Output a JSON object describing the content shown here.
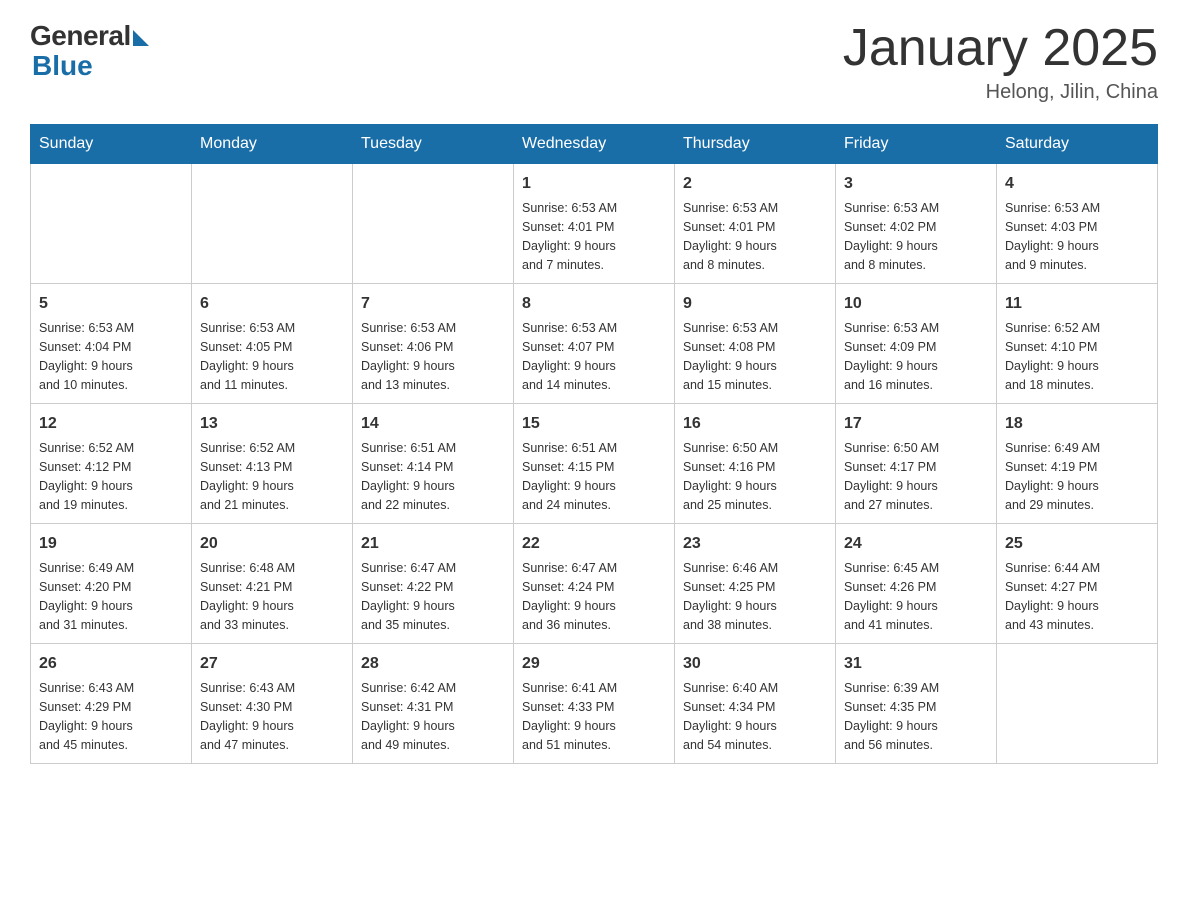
{
  "header": {
    "logo_general": "General",
    "logo_blue": "Blue",
    "title": "January 2025",
    "subtitle": "Helong, Jilin, China"
  },
  "days_of_week": [
    "Sunday",
    "Monday",
    "Tuesday",
    "Wednesday",
    "Thursday",
    "Friday",
    "Saturday"
  ],
  "weeks": [
    [
      null,
      null,
      null,
      {
        "date": "1",
        "sunrise": "6:53 AM",
        "sunset": "4:01 PM",
        "daylight": "9 hours and 7 minutes."
      },
      {
        "date": "2",
        "sunrise": "6:53 AM",
        "sunset": "4:01 PM",
        "daylight": "9 hours and 8 minutes."
      },
      {
        "date": "3",
        "sunrise": "6:53 AM",
        "sunset": "4:02 PM",
        "daylight": "9 hours and 8 minutes."
      },
      {
        "date": "4",
        "sunrise": "6:53 AM",
        "sunset": "4:03 PM",
        "daylight": "9 hours and 9 minutes."
      }
    ],
    [
      {
        "date": "5",
        "sunrise": "6:53 AM",
        "sunset": "4:04 PM",
        "daylight": "9 hours and 10 minutes."
      },
      {
        "date": "6",
        "sunrise": "6:53 AM",
        "sunset": "4:05 PM",
        "daylight": "9 hours and 11 minutes."
      },
      {
        "date": "7",
        "sunrise": "6:53 AM",
        "sunset": "4:06 PM",
        "daylight": "9 hours and 13 minutes."
      },
      {
        "date": "8",
        "sunrise": "6:53 AM",
        "sunset": "4:07 PM",
        "daylight": "9 hours and 14 minutes."
      },
      {
        "date": "9",
        "sunrise": "6:53 AM",
        "sunset": "4:08 PM",
        "daylight": "9 hours and 15 minutes."
      },
      {
        "date": "10",
        "sunrise": "6:53 AM",
        "sunset": "4:09 PM",
        "daylight": "9 hours and 16 minutes."
      },
      {
        "date": "11",
        "sunrise": "6:52 AM",
        "sunset": "4:10 PM",
        "daylight": "9 hours and 18 minutes."
      }
    ],
    [
      {
        "date": "12",
        "sunrise": "6:52 AM",
        "sunset": "4:12 PM",
        "daylight": "9 hours and 19 minutes."
      },
      {
        "date": "13",
        "sunrise": "6:52 AM",
        "sunset": "4:13 PM",
        "daylight": "9 hours and 21 minutes."
      },
      {
        "date": "14",
        "sunrise": "6:51 AM",
        "sunset": "4:14 PM",
        "daylight": "9 hours and 22 minutes."
      },
      {
        "date": "15",
        "sunrise": "6:51 AM",
        "sunset": "4:15 PM",
        "daylight": "9 hours and 24 minutes."
      },
      {
        "date": "16",
        "sunrise": "6:50 AM",
        "sunset": "4:16 PM",
        "daylight": "9 hours and 25 minutes."
      },
      {
        "date": "17",
        "sunrise": "6:50 AM",
        "sunset": "4:17 PM",
        "daylight": "9 hours and 27 minutes."
      },
      {
        "date": "18",
        "sunrise": "6:49 AM",
        "sunset": "4:19 PM",
        "daylight": "9 hours and 29 minutes."
      }
    ],
    [
      {
        "date": "19",
        "sunrise": "6:49 AM",
        "sunset": "4:20 PM",
        "daylight": "9 hours and 31 minutes."
      },
      {
        "date": "20",
        "sunrise": "6:48 AM",
        "sunset": "4:21 PM",
        "daylight": "9 hours and 33 minutes."
      },
      {
        "date": "21",
        "sunrise": "6:47 AM",
        "sunset": "4:22 PM",
        "daylight": "9 hours and 35 minutes."
      },
      {
        "date": "22",
        "sunrise": "6:47 AM",
        "sunset": "4:24 PM",
        "daylight": "9 hours and 36 minutes."
      },
      {
        "date": "23",
        "sunrise": "6:46 AM",
        "sunset": "4:25 PM",
        "daylight": "9 hours and 38 minutes."
      },
      {
        "date": "24",
        "sunrise": "6:45 AM",
        "sunset": "4:26 PM",
        "daylight": "9 hours and 41 minutes."
      },
      {
        "date": "25",
        "sunrise": "6:44 AM",
        "sunset": "4:27 PM",
        "daylight": "9 hours and 43 minutes."
      }
    ],
    [
      {
        "date": "26",
        "sunrise": "6:43 AM",
        "sunset": "4:29 PM",
        "daylight": "9 hours and 45 minutes."
      },
      {
        "date": "27",
        "sunrise": "6:43 AM",
        "sunset": "4:30 PM",
        "daylight": "9 hours and 47 minutes."
      },
      {
        "date": "28",
        "sunrise": "6:42 AM",
        "sunset": "4:31 PM",
        "daylight": "9 hours and 49 minutes."
      },
      {
        "date": "29",
        "sunrise": "6:41 AM",
        "sunset": "4:33 PM",
        "daylight": "9 hours and 51 minutes."
      },
      {
        "date": "30",
        "sunrise": "6:40 AM",
        "sunset": "4:34 PM",
        "daylight": "9 hours and 54 minutes."
      },
      {
        "date": "31",
        "sunrise": "6:39 AM",
        "sunset": "4:35 PM",
        "daylight": "9 hours and 56 minutes."
      },
      null
    ]
  ],
  "labels": {
    "sunrise_prefix": "Sunrise: ",
    "sunset_prefix": "Sunset: ",
    "daylight_prefix": "Daylight: "
  }
}
